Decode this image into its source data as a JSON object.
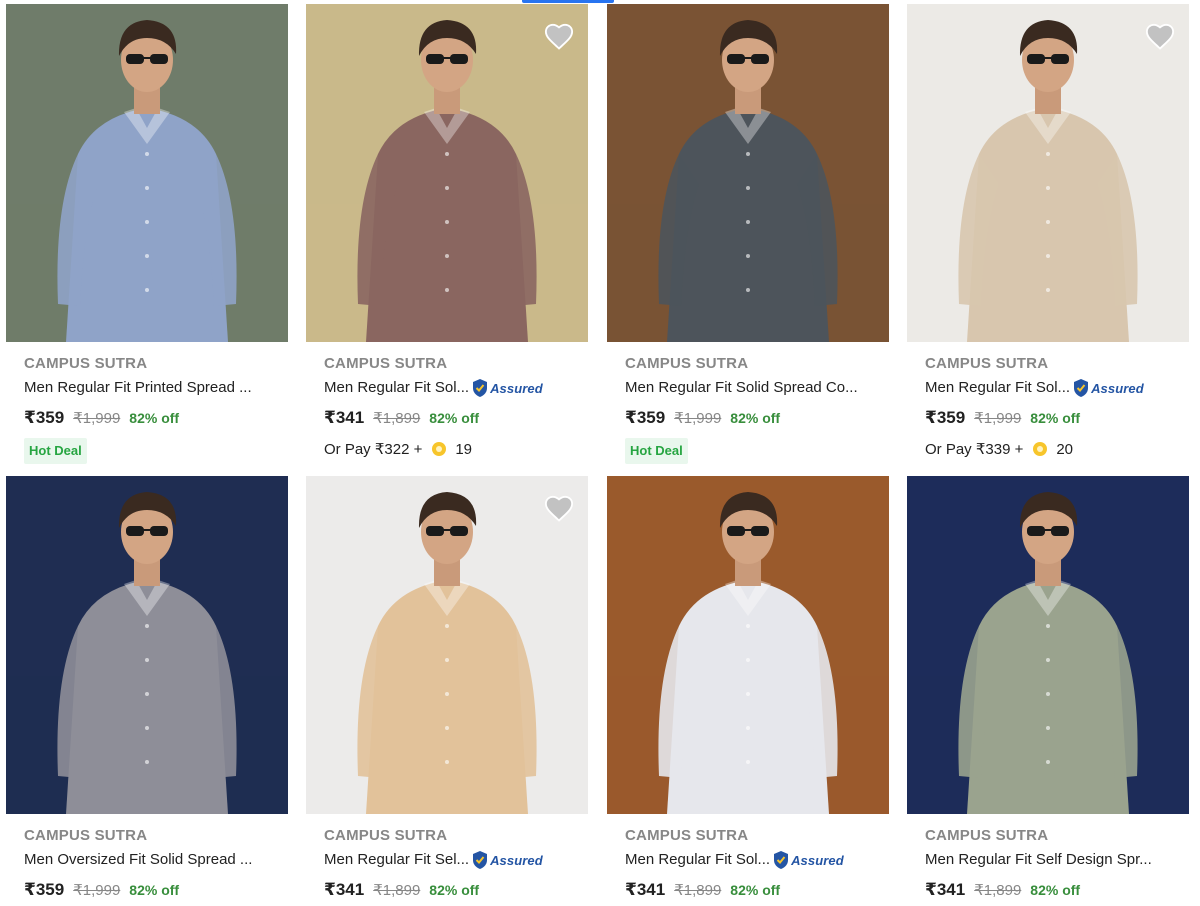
{
  "products": [
    {
      "brand": "CAMPUS SUTRA",
      "title": "Men Regular Fit Printed Spread ...",
      "assured": false,
      "price": "₹359",
      "mrp": "₹1,999",
      "off": "82% off",
      "badge": "Hot Deal",
      "pay": null,
      "wishlist": false,
      "shirt_color": "#8fa3c8",
      "bg": "#6f7c6a"
    },
    {
      "brand": "CAMPUS SUTRA",
      "title": "Men Regular Fit Sol...",
      "assured": true,
      "assured_text": "Assured",
      "price": "₹341",
      "mrp": "₹1,899",
      "off": "82% off",
      "badge": null,
      "pay": {
        "prefix": "Or Pay ₹322 +",
        "coins": "19"
      },
      "wishlist": true,
      "shirt_color": "#8a6660",
      "bg": "#c9b98a"
    },
    {
      "brand": "CAMPUS SUTRA",
      "title": "Men Regular Fit Solid Spread Co...",
      "assured": false,
      "price": "₹359",
      "mrp": "₹1,999",
      "off": "82% off",
      "badge": "Hot Deal",
      "pay": null,
      "wishlist": false,
      "shirt_color": "#4d545b",
      "bg": "#7a5334"
    },
    {
      "brand": "CAMPUS SUTRA",
      "title": "Men Regular Fit Sol...",
      "assured": true,
      "assured_text": "Assured",
      "price": "₹359",
      "mrp": "₹1,999",
      "off": "82% off",
      "badge": null,
      "pay": {
        "prefix": "Or Pay ₹339 +",
        "coins": "20"
      },
      "wishlist": true,
      "shirt_color": "#d8c6ae",
      "bg": "#eceae6"
    },
    {
      "brand": "CAMPUS SUTRA",
      "title": "Men Oversized Fit Solid Spread ...",
      "assured": false,
      "price": "₹359",
      "mrp": "₹1,999",
      "off": "82% off",
      "badge": null,
      "pay": null,
      "wishlist": false,
      "shirt_color": "#8e8e98",
      "bg": "#1f2d52"
    },
    {
      "brand": "CAMPUS SUTRA",
      "title": "Men Regular Fit Sel...",
      "assured": true,
      "assured_text": "Assured",
      "price": "₹341",
      "mrp": "₹1,899",
      "off": "82% off",
      "badge": null,
      "pay": null,
      "wishlist": true,
      "shirt_color": "#e2c29a",
      "bg": "#ecebea"
    },
    {
      "brand": "CAMPUS SUTRA",
      "title": "Men Regular Fit Sol...",
      "assured": true,
      "assured_text": "Assured",
      "price": "₹341",
      "mrp": "₹1,899",
      "off": "82% off",
      "badge": null,
      "pay": null,
      "wishlist": false,
      "shirt_color": "#e6e7ec",
      "bg": "#9a5a2c"
    },
    {
      "brand": "CAMPUS SUTRA",
      "title": "Men Regular Fit Self Design Spr...",
      "assured": false,
      "price": "₹341",
      "mrp": "₹1,899",
      "off": "82% off",
      "badge": null,
      "pay": null,
      "wishlist": false,
      "shirt_color": "#9aa38e",
      "bg": "#1d2c5a"
    }
  ]
}
